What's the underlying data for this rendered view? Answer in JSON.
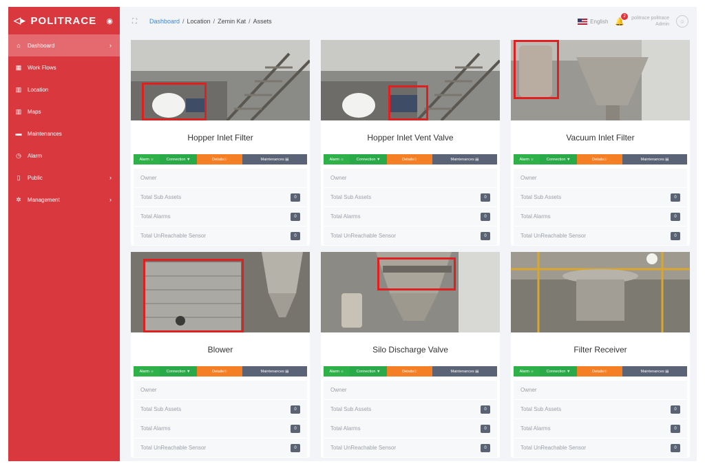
{
  "brand": {
    "logo": "◁▸",
    "name": "POLITRACE",
    "toggle_icon": "eye-icon"
  },
  "nav": [
    {
      "label": "Dashboard",
      "icon": "home-icon",
      "active": true,
      "chevron": true
    },
    {
      "label": "Work Flows",
      "icon": "grid-icon",
      "chevron": false
    },
    {
      "label": "Location",
      "icon": "building-icon",
      "chevron": false
    },
    {
      "label": "Maps",
      "icon": "map-icon",
      "chevron": false
    },
    {
      "label": "Maintenances",
      "icon": "wrench-icon",
      "chevron": false
    },
    {
      "label": "Alarm",
      "icon": "clock-icon",
      "chevron": false
    },
    {
      "label": "Public",
      "icon": "file-icon",
      "chevron": true
    },
    {
      "label": "Management",
      "icon": "gear-icon",
      "chevron": true
    }
  ],
  "breadcrumb": [
    "Dashboard",
    "Location",
    "Zemin Kat",
    "Assets"
  ],
  "topbar": {
    "language": "English",
    "notif_count": "2",
    "user_name": "politrace politrace",
    "user_role": "Admin"
  },
  "card_common": {
    "buttons": {
      "alarm": "Alarm ☼",
      "connection": "Connection ▼",
      "details": "Details☉",
      "maintenances": "Maintenances ▤"
    },
    "labels": {
      "owner": "Owner",
      "sub_assets": "Total Sub Assets",
      "alarms": "Total Alarms",
      "unreachable": "Total UnReachable Sensor"
    }
  },
  "cards": [
    {
      "title": "Hopper Inlet Filter",
      "sub_assets": "0",
      "alarms": "0",
      "unreachable": "0"
    },
    {
      "title": "Hopper Inlet Vent Valve",
      "sub_assets": "0",
      "alarms": "0",
      "unreachable": "0"
    },
    {
      "title": "Vacuum Inlet Filter",
      "sub_assets": "0",
      "alarms": "0",
      "unreachable": "0"
    },
    {
      "title": "Blower",
      "sub_assets": "0",
      "alarms": "0",
      "unreachable": "0"
    },
    {
      "title": "Silo Discharge Valve",
      "sub_assets": "0",
      "alarms": "0",
      "unreachable": "0"
    },
    {
      "title": "Filter Receiver",
      "sub_assets": "0",
      "alarms": "0",
      "unreachable": "0"
    }
  ],
  "colors": {
    "sidebar": "#d9383f",
    "alarm": "#2fb14a",
    "details": "#f47f24",
    "maintenances": "#5b6376",
    "highlight": "#e02020"
  }
}
